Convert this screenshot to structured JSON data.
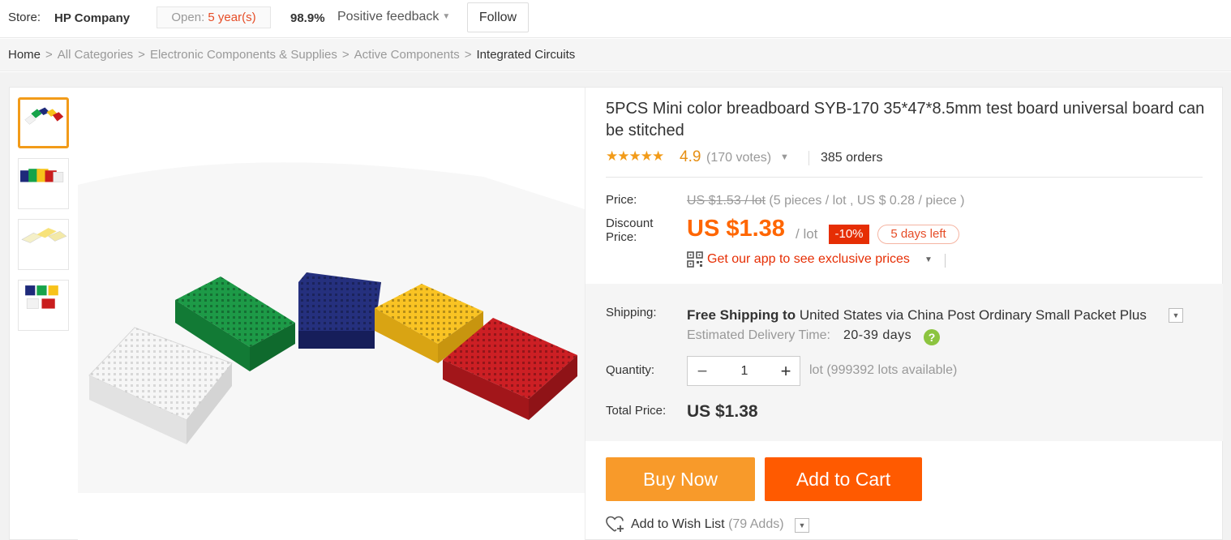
{
  "store": {
    "label": "Store:",
    "name": "HP Company",
    "open_label": "Open:",
    "open_value": "5 year(s)",
    "feedback_pct": "98.9%",
    "feedback_label": "Positive feedback",
    "follow_label": "Follow"
  },
  "breadcrumb": {
    "items": [
      "Home",
      "All Categories",
      "Electronic Components & Supplies",
      "Active Components",
      "Integrated Circuits"
    ],
    "separator": ">"
  },
  "product": {
    "title": "5PCS Mini color breadboard SYB-170 35*47*8.5mm test board universal board can be stitched",
    "rating": "4.9",
    "votes": "(170 votes)",
    "orders": "385 orders",
    "price_label": "Price:",
    "original_price": "US $1.53 / lot",
    "unit_info": "(5 pieces / lot , US $ 0.28 / piece )",
    "discount_price_label_1": "Discount",
    "discount_price_label_2": "Price:",
    "discount_price": "US $1.38",
    "per_lot": "/ lot",
    "discount_badge": "-10%",
    "days_left": "5 days left",
    "app_promo": "Get our app to see exclusive prices"
  },
  "shipping": {
    "label": "Shipping:",
    "free_shipping": "Free Shipping to",
    "destination": "United States via China Post Ordinary Small Packet Plus",
    "est_label": "Estimated Delivery Time:",
    "est_value": "20-39 days"
  },
  "quantity": {
    "label": "Quantity:",
    "value": "1",
    "minus": "−",
    "plus": "+",
    "available": "lot (999392 lots available)"
  },
  "total": {
    "label": "Total Price:",
    "value": "US $1.38"
  },
  "actions": {
    "buy_now": "Buy Now",
    "add_to_cart": "Add to Cart",
    "wish_list": "Add to Wish List",
    "wish_adds": "(79 Adds)"
  },
  "colors": {
    "accent_orange": "#ff6600",
    "buy_button": "#f89a2a",
    "cart_button": "#ff5a00",
    "discount_red": "#e62e04",
    "star": "#f29b19"
  },
  "icons": [
    "star-icon",
    "qr-code-icon",
    "help-icon",
    "heart-plus-icon",
    "chevron-down-icon"
  ]
}
